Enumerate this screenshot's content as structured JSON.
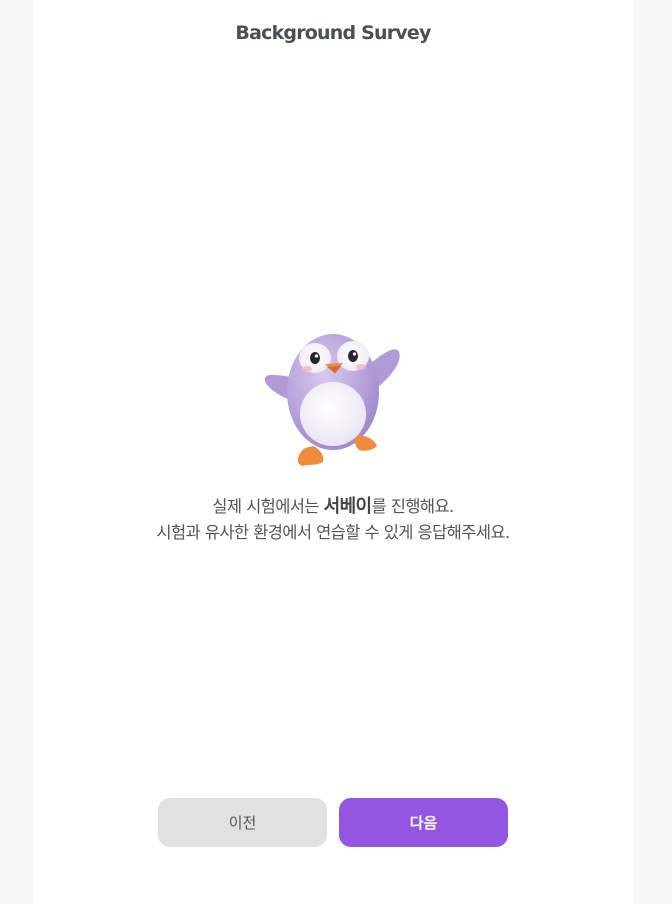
{
  "header": {
    "title": "Background Survey"
  },
  "mascot": {
    "icon": "penguin-mascot",
    "body_color": "#b9a6d9"
  },
  "message": {
    "line1_prefix": "실제 시험에서는 ",
    "line1_emphasis": "서베이",
    "line1_suffix": "를 진행해요.",
    "line2": "시험과 유사한 환경에서 연습할 수 있게 응답해주세요."
  },
  "footer": {
    "prev_label": "이전",
    "next_label": "다음",
    "next_color": "#9456e0",
    "prev_color": "#e1e1e1"
  }
}
